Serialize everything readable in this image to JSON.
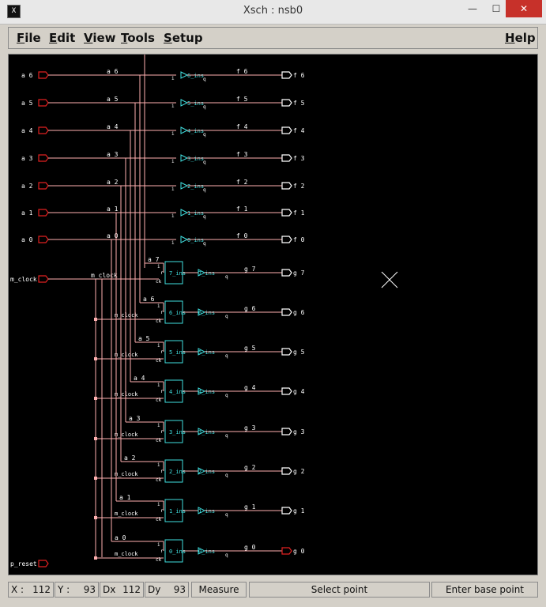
{
  "window": {
    "title": "Xsch : nsb0",
    "app_icon": "X",
    "min": "—",
    "max": "☐",
    "close": "✕"
  },
  "menu": {
    "file": "File",
    "edit": "Edit",
    "view": "View",
    "tools": "Tools",
    "setup": "Setup",
    "help": "Help"
  },
  "status": {
    "x_label": "X :",
    "x_value": "112",
    "y_label": "Y :",
    "y_value": "93",
    "dx_label": "Dx",
    "dx_value": "112",
    "dy_label": "Dy",
    "dy_value": "93",
    "measure": "Measure",
    "select_point": "Select point",
    "enter_base_point": "Enter base point"
  },
  "schematic": {
    "a_inputs": [
      "a 6",
      "a 5",
      "a 4",
      "a 3",
      "a 2",
      "a 1",
      "a 0"
    ],
    "a_nets": [
      "a 6",
      "a 5",
      "a 4",
      "a 3",
      "a 2",
      "a 1",
      "a 0"
    ],
    "f_nets": [
      "f 6",
      "f 5",
      "f 4",
      "f 3",
      "f 2",
      "f 1",
      "f 0"
    ],
    "f_outputs": [
      "f 6",
      "f 5",
      "f 4",
      "f 3",
      "f 2",
      "f 1",
      "f 0"
    ],
    "buf_labels": [
      "6_ins",
      "5_ins",
      "4_ins",
      "3_ins",
      "2_ins",
      "1_ins",
      "0_ins"
    ],
    "clock_input": "m_clock",
    "clock_net": "m_clock",
    "reset_input": "p_reset",
    "ff_a_nets": [
      "a 7",
      "a 6",
      "a 5",
      "a 4",
      "a 3",
      "a 2",
      "a 1",
      "a 0"
    ],
    "ff_labels": [
      "7_ins",
      "6_ins",
      "5_ins",
      "4_ins",
      "3_ins",
      "2_ins",
      "1_ins",
      "0_ins"
    ],
    "ff_buf_labels": [
      "7_ins",
      "6_ins",
      "5_ins",
      "4_ins",
      "3_ins",
      "2_ins",
      "1_ins",
      "0_ins"
    ],
    "g_nets": [
      "g 7",
      "g 6",
      "g 5",
      "g 4",
      "g 3",
      "g 2",
      "g 1",
      "g 0"
    ],
    "g_outputs": [
      "g 7",
      "g 6",
      "g 5",
      "g 4",
      "g 3",
      "g 2",
      "g 1",
      "g 0"
    ],
    "pin_i": "i",
    "pin_q": "q",
    "pin_r": "r",
    "pin_ck": "ck",
    "colors": {
      "wire": "#ffb0b0",
      "port_in": "#e02020",
      "port_out": "#ffffff",
      "symbol": "#40e0e0",
      "text": "#ffffff",
      "background": "#000000"
    }
  }
}
